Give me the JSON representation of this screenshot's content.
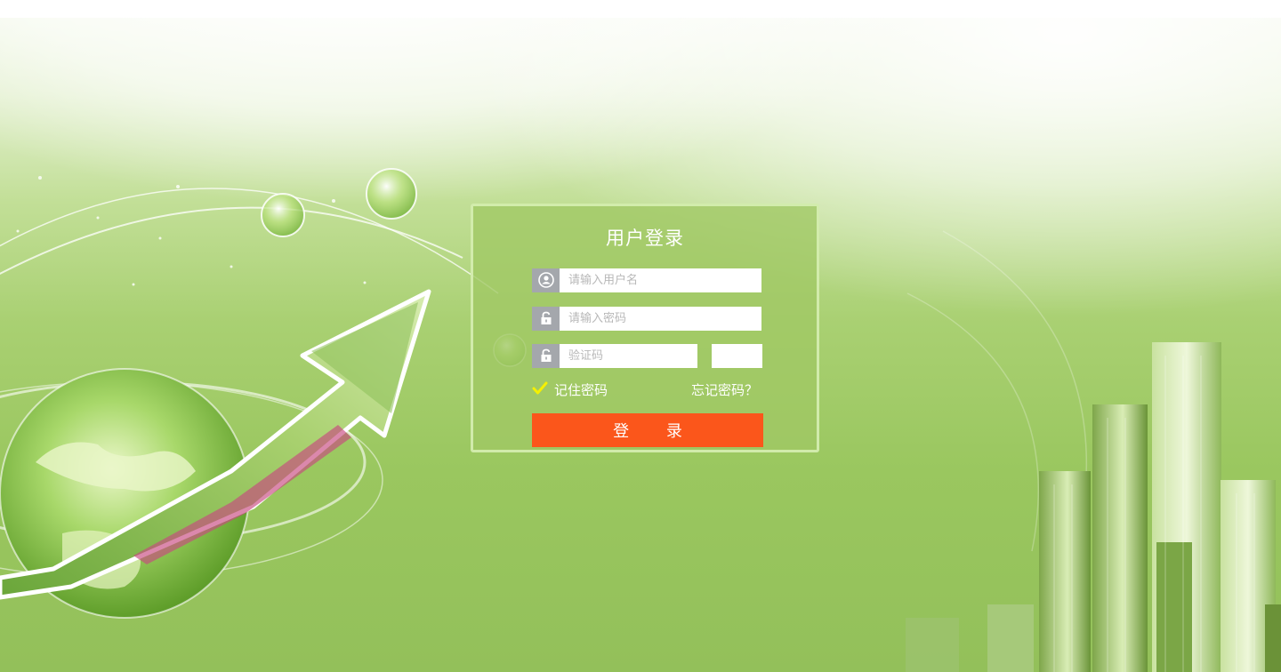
{
  "login": {
    "title": "用户登录",
    "username_placeholder": "请输入用户名",
    "password_placeholder": "请输入密码",
    "captcha_placeholder": "验证码",
    "remember_label": "记住密码",
    "forgot_label": "忘记密码？",
    "submit_label": "登 录",
    "remember_checked": true
  },
  "icons": {
    "username": "user-icon",
    "password": "lock-icon",
    "captcha": "lock-icon",
    "remember": "checkmark-icon"
  },
  "colors": {
    "login_button": "#fb561b",
    "panel_bg": "#a0c864",
    "icon_bg": "#a4a7ac",
    "checkmark": "#f5f000"
  }
}
